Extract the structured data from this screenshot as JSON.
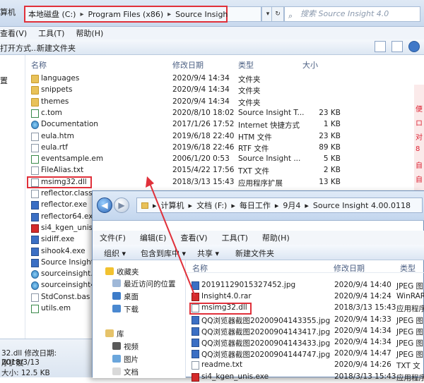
{
  "bg_window": {
    "left_cut_label": "算机",
    "breadcrumb": [
      "本地磁盘 (C:)",
      "Program Files (x86)",
      "Source Insight 4.0"
    ],
    "search_placeholder": "搜索 Source Insight 4.0",
    "menu": [
      "查看(V)",
      "工具(T)",
      "帮助(H)"
    ],
    "toolbar": [
      "打开方式...",
      "新建文件夹"
    ],
    "nav_cut": [
      "置"
    ],
    "columns": [
      "名称",
      "修改日期",
      "类型",
      "大小"
    ],
    "rows": [
      {
        "icon": "folder-icon",
        "name": "languages",
        "date": "2020/9/4 14:34",
        "type": "文件夹",
        "size": ""
      },
      {
        "icon": "folder-icon",
        "name": "snippets",
        "date": "2020/9/4 14:34",
        "type": "文件夹",
        "size": ""
      },
      {
        "icon": "folder-icon",
        "name": "themes",
        "date": "2020/9/4 14:34",
        "type": "文件夹",
        "size": ""
      },
      {
        "icon": "source-insight-file-icon",
        "name": "c.tom",
        "date": "2020/8/10 18:02",
        "type": "Source Insight T...",
        "size": "23 KB"
      },
      {
        "icon": "internet-shortcut-icon",
        "name": "Documentation",
        "date": "2017/1/26 17:52",
        "type": "Internet 快捷方式",
        "size": "1 KB"
      },
      {
        "icon": "htm-file-icon",
        "name": "eula.htm",
        "date": "2019/6/18 22:40",
        "type": "HTM 文件",
        "size": "23 KB"
      },
      {
        "icon": "rtf-file-icon",
        "name": "eula.rtf",
        "date": "2019/6/18 22:46",
        "type": "RTF 文件",
        "size": "89 KB"
      },
      {
        "icon": "source-insight-file-icon",
        "name": "eventsample.em",
        "date": "2006/1/20 0:53",
        "type": "Source Insight ...",
        "size": "5 KB"
      },
      {
        "icon": "txt-file-icon",
        "name": "FileAlias.txt",
        "date": "2015/4/22 17:56",
        "type": "TXT 文件",
        "size": "2 KB"
      },
      {
        "icon": "dll-file-icon",
        "name": "msimg32.dll",
        "date": "2018/3/13 15:43",
        "type": "应用程序扩展",
        "size": "13 KB"
      },
      {
        "icon": "file-icon",
        "name": "reflector.class",
        "date": "",
        "type": "",
        "size": ""
      },
      {
        "icon": "exe-icon",
        "name": "reflector.exe",
        "date": "",
        "type": "",
        "size": ""
      },
      {
        "icon": "exe-icon",
        "name": "reflector64.exe",
        "date": "",
        "type": "",
        "size": ""
      },
      {
        "icon": "keygen-icon",
        "name": "si4_kgen_unis.e",
        "date": "",
        "type": "",
        "size": ""
      },
      {
        "icon": "exe-icon",
        "name": "sidiff.exe",
        "date": "",
        "type": "",
        "size": ""
      },
      {
        "icon": "exe-icon",
        "name": "sihook4.exe",
        "date": "",
        "type": "",
        "size": ""
      },
      {
        "icon": "source-insight-app-icon",
        "name": "Source Insight",
        "date": "",
        "type": "",
        "size": ""
      },
      {
        "icon": "globe-icon",
        "name": "sourceinsight.cl",
        "date": "",
        "type": "",
        "size": ""
      },
      {
        "icon": "globe-icon",
        "name": "sourceinsight4.",
        "date": "",
        "type": "",
        "size": ""
      },
      {
        "icon": "file-icon",
        "name": "StdConst.bas",
        "date": "",
        "type": "",
        "size": ""
      },
      {
        "icon": "source-insight-file-icon",
        "name": "utils.em",
        "date": "",
        "type": "",
        "size": ""
      }
    ],
    "status": [
      "32.dll 修改日期: 2018/3/13",
      "序扩展",
      "大小: 12.5 KB"
    ],
    "right_edge_chars": [
      "便",
      "ロ",
      "对",
      "8",
      "自",
      "自"
    ]
  },
  "fg_window": {
    "breadcrumb": [
      "计算机",
      "文档 (F:)",
      "每日工作",
      "9月4",
      "Source Insight 4.00.0118"
    ],
    "menu": [
      "文件(F)",
      "编辑(E)",
      "查看(V)",
      "工具(T)",
      "帮助(H)"
    ],
    "toolbar": [
      "组织 ▾",
      "包含到库中 ▾",
      "共享 ▾",
      "新建文件夹"
    ],
    "nav": {
      "favorites": "收藏夹",
      "favorites_items": [
        "最近访问的位置",
        "桌面",
        "下载"
      ],
      "library": "库",
      "library_items": [
        "视频",
        "图片",
        "文档"
      ]
    },
    "columns": [
      "名称",
      "修改日期",
      "类型"
    ],
    "rows": [
      {
        "icon": "jpeg-icon",
        "name": "20191129015327452.jpg",
        "date": "2020/9/4 14:40",
        "type": "JPEG 图"
      },
      {
        "icon": "rar-icon",
        "name": "Insight4.0.rar",
        "date": "2020/9/4 14:24",
        "type": "WinRAR"
      },
      {
        "icon": "dll-file-icon",
        "name": "msimg32.dll",
        "date": "2018/3/13 15:43",
        "type": "应用程序"
      },
      {
        "icon": "jpeg-icon",
        "name": "QQ浏览器截图20200904143355.jpg",
        "date": "2020/9/4 14:33",
        "type": "JPEG 图"
      },
      {
        "icon": "jpeg-icon",
        "name": "QQ浏览器截图20200904143417.jpg",
        "date": "2020/9/4 14:34",
        "type": "JPEG 图"
      },
      {
        "icon": "jpeg-icon",
        "name": "QQ浏览器截图20200904143433.jpg",
        "date": "2020/9/4 14:34",
        "type": "JPEG 图"
      },
      {
        "icon": "jpeg-icon",
        "name": "QQ浏览器截图20200904144747.jpg",
        "date": "2020/9/4 14:47",
        "type": "JPEG 图"
      },
      {
        "icon": "txt-file-icon",
        "name": "readme.txt",
        "date": "2020/9/4 14:26",
        "type": "TXT 文"
      },
      {
        "icon": "keygen-icon",
        "name": "si4_kgen_unis.exe",
        "date": "2018/3/13 15:43",
        "type": "应用程序"
      }
    ]
  },
  "colors": {
    "highlight": "#e0303a",
    "folder": "#e8c25a",
    "header_text": "#4d6184"
  }
}
